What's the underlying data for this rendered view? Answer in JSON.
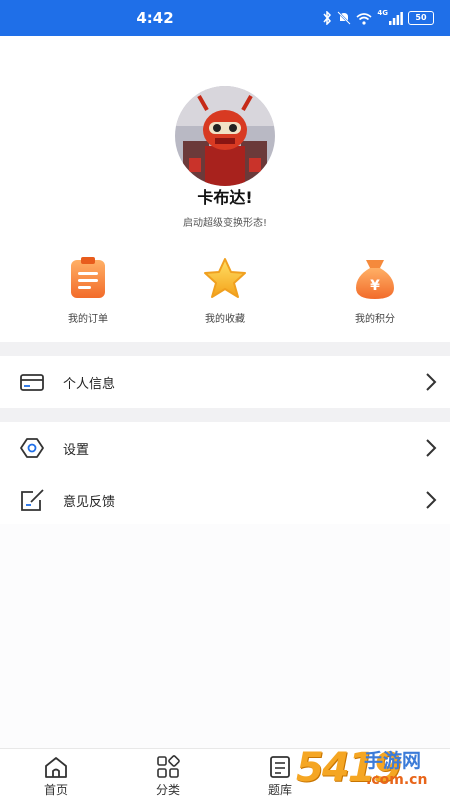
{
  "status_bar": {
    "time": "4:42",
    "battery": "50",
    "network_label": "4G",
    "bg_color": "#1f6fe8"
  },
  "profile": {
    "avatar_alt": "robot-avatar",
    "username": "卡布达!",
    "tagline": "启动超级变换形态!"
  },
  "quick_actions": [
    {
      "label": "我的订单",
      "icon": "order-icon"
    },
    {
      "label": "我的收藏",
      "icon": "star-icon"
    },
    {
      "label": "我的积分",
      "icon": "money-bag-icon"
    }
  ],
  "menu": {
    "personal_info": {
      "label": "个人信息",
      "icon": "card-icon"
    },
    "settings": {
      "label": "设置",
      "icon": "gear-icon"
    },
    "feedback": {
      "label": "意见反馈",
      "icon": "edit-icon"
    }
  },
  "tab_bar": [
    {
      "label": "首页",
      "icon": "home-icon"
    },
    {
      "label": "分类",
      "icon": "category-icon"
    },
    {
      "label": "题库",
      "icon": "question-bank-icon"
    }
  ],
  "watermark": {
    "number": "5419",
    "site_name": "手游网",
    "domain": ".com.cn"
  }
}
